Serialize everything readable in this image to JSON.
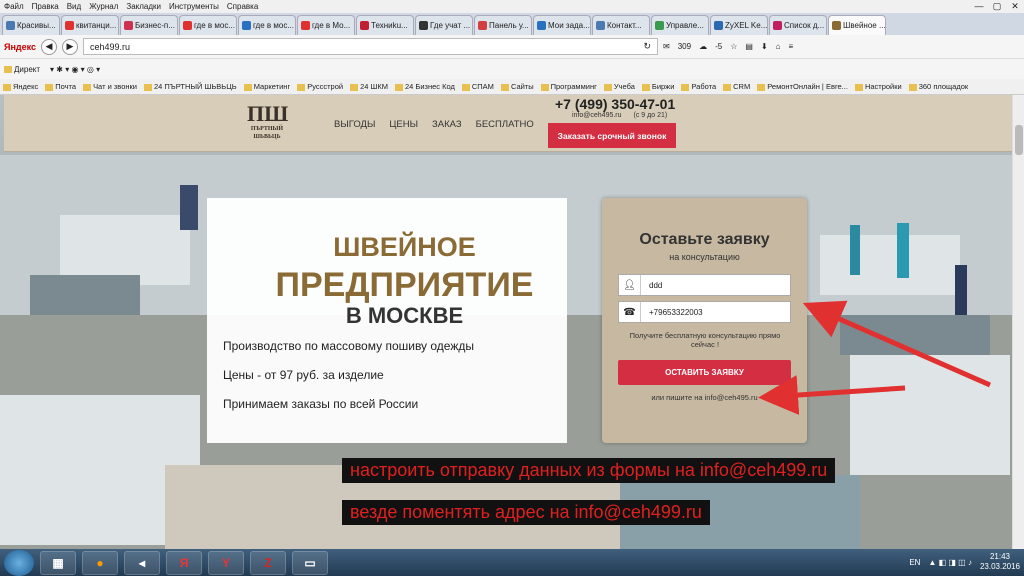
{
  "browser": {
    "menu": [
      "Файл",
      "Правка",
      "Вид",
      "Журнал",
      "Закладки",
      "Инструменты",
      "Справка"
    ],
    "tabs": [
      {
        "label": "Красивы...",
        "color": "#4a7ab0"
      },
      {
        "label": "квитанци...",
        "color": "#e03030"
      },
      {
        "label": "Бизнес-п...",
        "color": "#d03050"
      },
      {
        "label": "где в мос...",
        "color": "#e03030"
      },
      {
        "label": "где в мос...",
        "color": "#2a70c0"
      },
      {
        "label": "где в Мо...",
        "color": "#e03030"
      },
      {
        "label": "Техниku...",
        "color": "#c02030"
      },
      {
        "label": "Где учат ...",
        "color": "#333"
      },
      {
        "label": "Панель у...",
        "color": "#d04040"
      },
      {
        "label": "Мои зада...",
        "color": "#2a70c0"
      },
      {
        "label": "Контакт...",
        "color": "#4a7ab0"
      },
      {
        "label": "Управле...",
        "color": "#3a9a50"
      },
      {
        "label": "ZyXEL Ke...",
        "color": "#2a6ab0"
      },
      {
        "label": "Список д...",
        "color": "#c02060"
      },
      {
        "label": "Швейное ...",
        "color": "#8a6a35"
      }
    ],
    "url": "ceh499.ru",
    "yandex": "Яндекс",
    "mail_count": "309",
    "weather": "-5",
    "bm1": [
      "Директ"
    ],
    "bookmarks": [
      "Яндекс",
      "Почта",
      "Чат и звонки",
      "24 ПЪРТНЫЙ ШЬВЬЦЬ",
      "Маркетинг",
      "Руссстрой",
      "24 ШКМ",
      "24 Бизнес Код",
      "СПАМ",
      "Сайты",
      "Программинг",
      "Учеба",
      "Биржи",
      "Работа",
      "CRM",
      "РемонтОнлайн | Евге...",
      "Настройки",
      "360 площадок"
    ]
  },
  "site": {
    "logo_big": "ПШ",
    "logo_small": "ПЪРТНЫЙ ШЬВЬЦЬ",
    "nav": [
      "ВЫГОДЫ",
      "ЦЕНЫ",
      "ЗАКАЗ",
      "БЕСПЛАТНО"
    ],
    "phone": "+7 (499) 350-47-01",
    "email": "info@ceh495.ru",
    "hours": "(с 9 до 21)",
    "call_button": "Заказать срочный звонок",
    "hero_line1": "ШВЕЙНОЕ",
    "hero_line2": "ПРЕДПРИЯТИЕ",
    "hero_line3": "В МОСКВЕ",
    "bullets": [
      "Производство по массовому пошиву одежды",
      "Цены - от 97 руб. за изделие",
      "Принимаем заказы по всей России"
    ]
  },
  "form": {
    "title": "Оставьте заявку",
    "subtitle": "на консультацию",
    "name_value": "ddd",
    "phone_value": "+79653322003",
    "note": "Получите бесплатную консультацию прямо сейчас !",
    "submit": "ОСТАВИТЬ ЗАЯВКУ",
    "or_line": "или пишите на info@ceh495.ru"
  },
  "annotations": {
    "line1": "настроить отправку данных из формы на info@ceh499.ru",
    "line2": "везде поментять адрес на info@ceh499.ru"
  },
  "taskbar": {
    "lang": "EN",
    "time": "21:43",
    "date": "23.03.2016"
  }
}
